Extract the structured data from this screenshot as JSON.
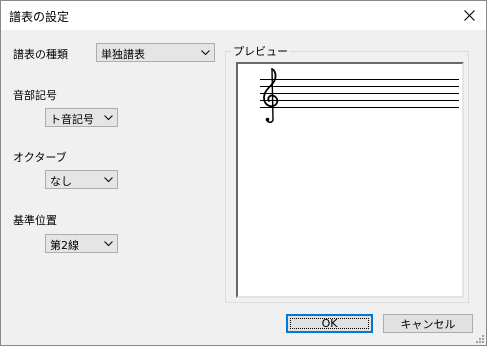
{
  "window": {
    "title": "譜表の設定"
  },
  "staff_type": {
    "label": "譜表の種類",
    "value": "単独譜表"
  },
  "clef": {
    "label": "音部記号",
    "value": "ト音記号"
  },
  "octave": {
    "label": "オクターブ",
    "value": "なし"
  },
  "base_position": {
    "label": "基準位置",
    "value": "第2線"
  },
  "preview": {
    "label": "プレビュー",
    "clef_symbol": "treble-clef",
    "staff_lines": 5
  },
  "buttons": {
    "ok": "OK",
    "cancel": "キャンセル"
  },
  "icons": {
    "close": "close-icon",
    "dropdown": "chevron-down-icon"
  }
}
